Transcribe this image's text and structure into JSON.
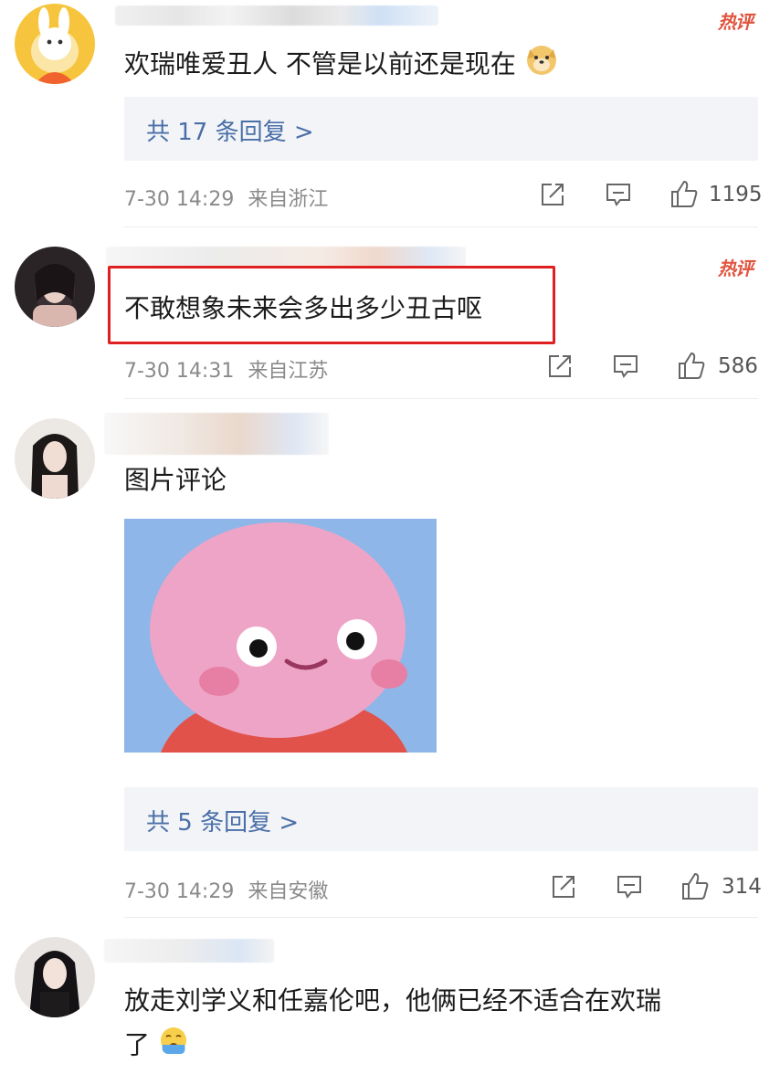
{
  "comments": [
    {
      "hot_label": "热评",
      "text": "欢瑞唯爱丑人 不管是以前还是现在",
      "emoji": "doge-emoji",
      "replies": "共 17 条回复 >",
      "time": "7-30 14:29",
      "location": "来自浙江",
      "likes": "1195"
    },
    {
      "hot_label": "热评",
      "text": "不敢想象未来会多出多少丑古呕",
      "time": "7-30 14:31",
      "location": "来自江苏",
      "likes": "586",
      "highlight_color": "#e02020"
    },
    {
      "text": "图片评论",
      "image": "cartoon-pink-pig-face",
      "replies": "共 5 条回复 >",
      "time": "7-30 14:29",
      "location": "来自安徽",
      "likes": "314"
    },
    {
      "text_line1": "放走刘学义和任嘉伦吧，他俩已经不适合在欢瑞",
      "text_line2": "了",
      "emoji": "crying-face-emoji"
    }
  ],
  "colors": {
    "hot": "#e0533d",
    "link": "#4a6fa8",
    "highlight": "#e02020"
  }
}
